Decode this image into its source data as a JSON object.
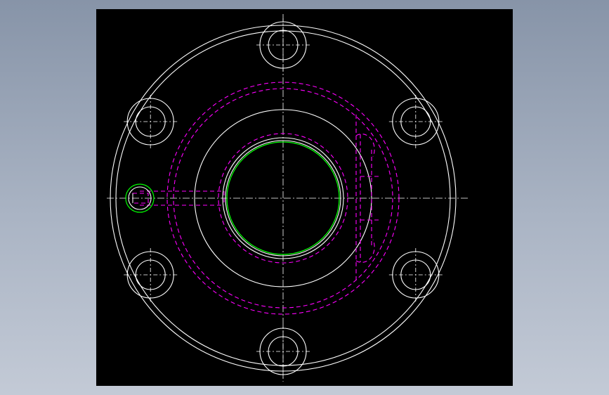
{
  "drawing": {
    "name": "flange-top-view",
    "colors": {
      "background": "#000000",
      "outline": "#ffffff",
      "hidden": "#ff00ff",
      "thread": "#00ff00",
      "centerline": "#ffffff"
    },
    "bolt_hole_count": 6,
    "features": [
      "outer-rim",
      "bolt-circle-holes",
      "hidden-counterbore",
      "central-bore",
      "threaded-bore",
      "side-port",
      "keyway-slot"
    ]
  }
}
